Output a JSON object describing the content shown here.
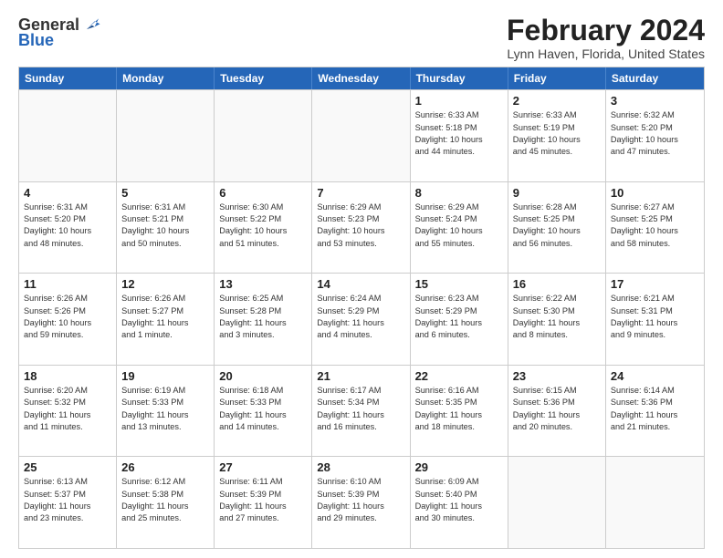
{
  "logo": {
    "general": "General",
    "blue": "Blue"
  },
  "title": "February 2024",
  "subtitle": "Lynn Haven, Florida, United States",
  "header_days": [
    "Sunday",
    "Monday",
    "Tuesday",
    "Wednesday",
    "Thursday",
    "Friday",
    "Saturday"
  ],
  "rows": [
    [
      {
        "day": "",
        "info": ""
      },
      {
        "day": "",
        "info": ""
      },
      {
        "day": "",
        "info": ""
      },
      {
        "day": "",
        "info": ""
      },
      {
        "day": "1",
        "info": "Sunrise: 6:33 AM\nSunset: 5:18 PM\nDaylight: 10 hours\nand 44 minutes."
      },
      {
        "day": "2",
        "info": "Sunrise: 6:33 AM\nSunset: 5:19 PM\nDaylight: 10 hours\nand 45 minutes."
      },
      {
        "day": "3",
        "info": "Sunrise: 6:32 AM\nSunset: 5:20 PM\nDaylight: 10 hours\nand 47 minutes."
      }
    ],
    [
      {
        "day": "4",
        "info": "Sunrise: 6:31 AM\nSunset: 5:20 PM\nDaylight: 10 hours\nand 48 minutes."
      },
      {
        "day": "5",
        "info": "Sunrise: 6:31 AM\nSunset: 5:21 PM\nDaylight: 10 hours\nand 50 minutes."
      },
      {
        "day": "6",
        "info": "Sunrise: 6:30 AM\nSunset: 5:22 PM\nDaylight: 10 hours\nand 51 minutes."
      },
      {
        "day": "7",
        "info": "Sunrise: 6:29 AM\nSunset: 5:23 PM\nDaylight: 10 hours\nand 53 minutes."
      },
      {
        "day": "8",
        "info": "Sunrise: 6:29 AM\nSunset: 5:24 PM\nDaylight: 10 hours\nand 55 minutes."
      },
      {
        "day": "9",
        "info": "Sunrise: 6:28 AM\nSunset: 5:25 PM\nDaylight: 10 hours\nand 56 minutes."
      },
      {
        "day": "10",
        "info": "Sunrise: 6:27 AM\nSunset: 5:25 PM\nDaylight: 10 hours\nand 58 minutes."
      }
    ],
    [
      {
        "day": "11",
        "info": "Sunrise: 6:26 AM\nSunset: 5:26 PM\nDaylight: 10 hours\nand 59 minutes."
      },
      {
        "day": "12",
        "info": "Sunrise: 6:26 AM\nSunset: 5:27 PM\nDaylight: 11 hours\nand 1 minute."
      },
      {
        "day": "13",
        "info": "Sunrise: 6:25 AM\nSunset: 5:28 PM\nDaylight: 11 hours\nand 3 minutes."
      },
      {
        "day": "14",
        "info": "Sunrise: 6:24 AM\nSunset: 5:29 PM\nDaylight: 11 hours\nand 4 minutes."
      },
      {
        "day": "15",
        "info": "Sunrise: 6:23 AM\nSunset: 5:29 PM\nDaylight: 11 hours\nand 6 minutes."
      },
      {
        "day": "16",
        "info": "Sunrise: 6:22 AM\nSunset: 5:30 PM\nDaylight: 11 hours\nand 8 minutes."
      },
      {
        "day": "17",
        "info": "Sunrise: 6:21 AM\nSunset: 5:31 PM\nDaylight: 11 hours\nand 9 minutes."
      }
    ],
    [
      {
        "day": "18",
        "info": "Sunrise: 6:20 AM\nSunset: 5:32 PM\nDaylight: 11 hours\nand 11 minutes."
      },
      {
        "day": "19",
        "info": "Sunrise: 6:19 AM\nSunset: 5:33 PM\nDaylight: 11 hours\nand 13 minutes."
      },
      {
        "day": "20",
        "info": "Sunrise: 6:18 AM\nSunset: 5:33 PM\nDaylight: 11 hours\nand 14 minutes."
      },
      {
        "day": "21",
        "info": "Sunrise: 6:17 AM\nSunset: 5:34 PM\nDaylight: 11 hours\nand 16 minutes."
      },
      {
        "day": "22",
        "info": "Sunrise: 6:16 AM\nSunset: 5:35 PM\nDaylight: 11 hours\nand 18 minutes."
      },
      {
        "day": "23",
        "info": "Sunrise: 6:15 AM\nSunset: 5:36 PM\nDaylight: 11 hours\nand 20 minutes."
      },
      {
        "day": "24",
        "info": "Sunrise: 6:14 AM\nSunset: 5:36 PM\nDaylight: 11 hours\nand 21 minutes."
      }
    ],
    [
      {
        "day": "25",
        "info": "Sunrise: 6:13 AM\nSunset: 5:37 PM\nDaylight: 11 hours\nand 23 minutes."
      },
      {
        "day": "26",
        "info": "Sunrise: 6:12 AM\nSunset: 5:38 PM\nDaylight: 11 hours\nand 25 minutes."
      },
      {
        "day": "27",
        "info": "Sunrise: 6:11 AM\nSunset: 5:39 PM\nDaylight: 11 hours\nand 27 minutes."
      },
      {
        "day": "28",
        "info": "Sunrise: 6:10 AM\nSunset: 5:39 PM\nDaylight: 11 hours\nand 29 minutes."
      },
      {
        "day": "29",
        "info": "Sunrise: 6:09 AM\nSunset: 5:40 PM\nDaylight: 11 hours\nand 30 minutes."
      },
      {
        "day": "",
        "info": ""
      },
      {
        "day": "",
        "info": ""
      }
    ]
  ]
}
